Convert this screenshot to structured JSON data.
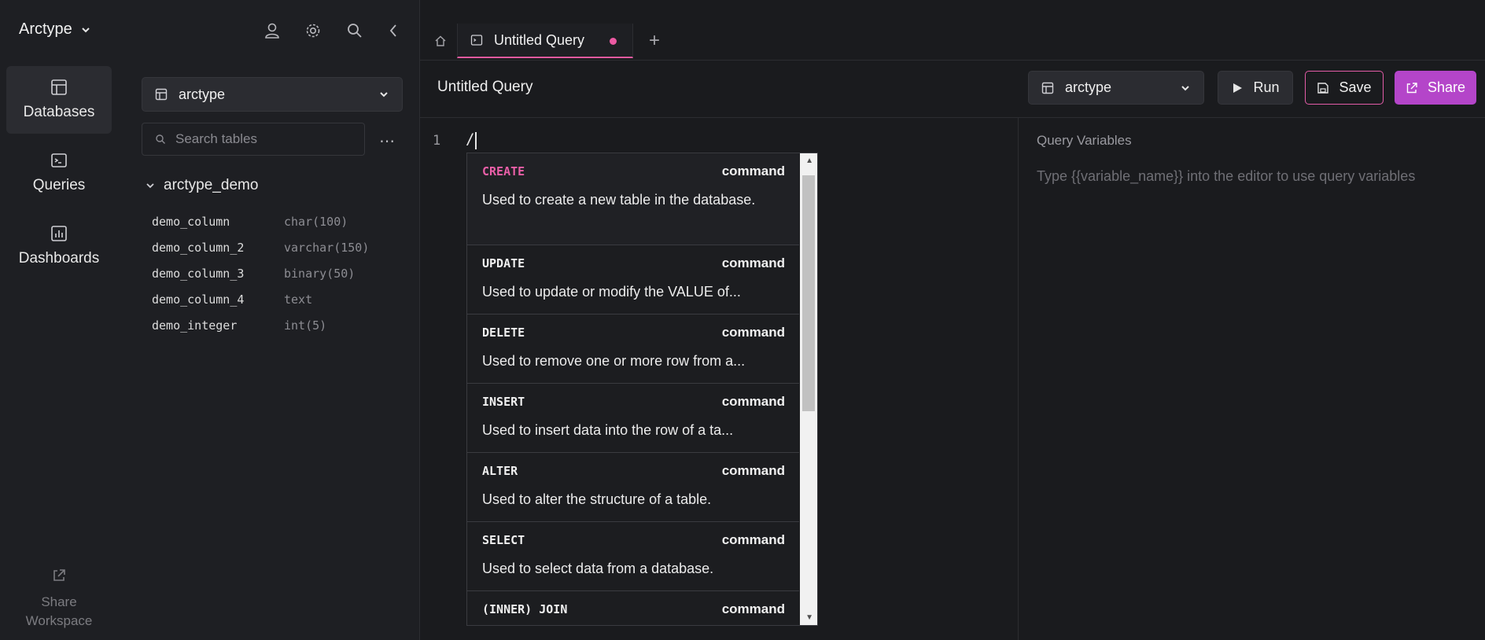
{
  "app": {
    "name": "Arctype"
  },
  "nav": {
    "items": [
      {
        "label": "Databases",
        "icon": "table-icon",
        "active": true
      },
      {
        "label": "Queries",
        "icon": "terminal-icon",
        "active": false
      },
      {
        "label": "Dashboards",
        "icon": "chart-icon",
        "active": false
      }
    ],
    "share_workspace": "Share Workspace"
  },
  "sidebar": {
    "database": "arctype",
    "search_placeholder": "Search tables",
    "more": "⋯",
    "table": "arctype_demo",
    "columns": [
      {
        "name": "demo_column",
        "type": "char(100)"
      },
      {
        "name": "demo_column_2",
        "type": "varchar(150)"
      },
      {
        "name": "demo_column_3",
        "type": "binary(50)"
      },
      {
        "name": "demo_column_4",
        "type": "text"
      },
      {
        "name": "demo_integer",
        "type": "int(5)"
      }
    ]
  },
  "tabs": {
    "active_label": "Untitled Query",
    "add": "+"
  },
  "toolbar": {
    "title": "Untitled Query",
    "connection": "arctype",
    "run_label": "Run",
    "save_label": "Save",
    "share_label": "Share"
  },
  "editor": {
    "line_number": "1",
    "text": "/"
  },
  "query_variables": {
    "title": "Query Variables",
    "hint": "Type {{variable_name}} into the editor to use query variables"
  },
  "autocomplete": {
    "items": [
      {
        "keyword": "CREATE",
        "kind": "command",
        "description": "Used to create a new table in the database."
      },
      {
        "keyword": "UPDATE",
        "kind": "command",
        "description": "Used to update or modify the VALUE of..."
      },
      {
        "keyword": "DELETE",
        "kind": "command",
        "description": "Used to remove one or more row from a..."
      },
      {
        "keyword": "INSERT",
        "kind": "command",
        "description": "Used to insert data into the row of a ta..."
      },
      {
        "keyword": "ALTER",
        "kind": "command",
        "description": "Used to alter the structure of a table."
      },
      {
        "keyword": "SELECT",
        "kind": "command",
        "description": "Used to select data from a database."
      },
      {
        "keyword": "(INNER) JOIN",
        "kind": "command",
        "description": ""
      }
    ]
  },
  "colors": {
    "accent": "#b445c9",
    "accent_pink": "#e25ca7",
    "background": "#1a1b1e",
    "panel": "#1e1f23"
  }
}
